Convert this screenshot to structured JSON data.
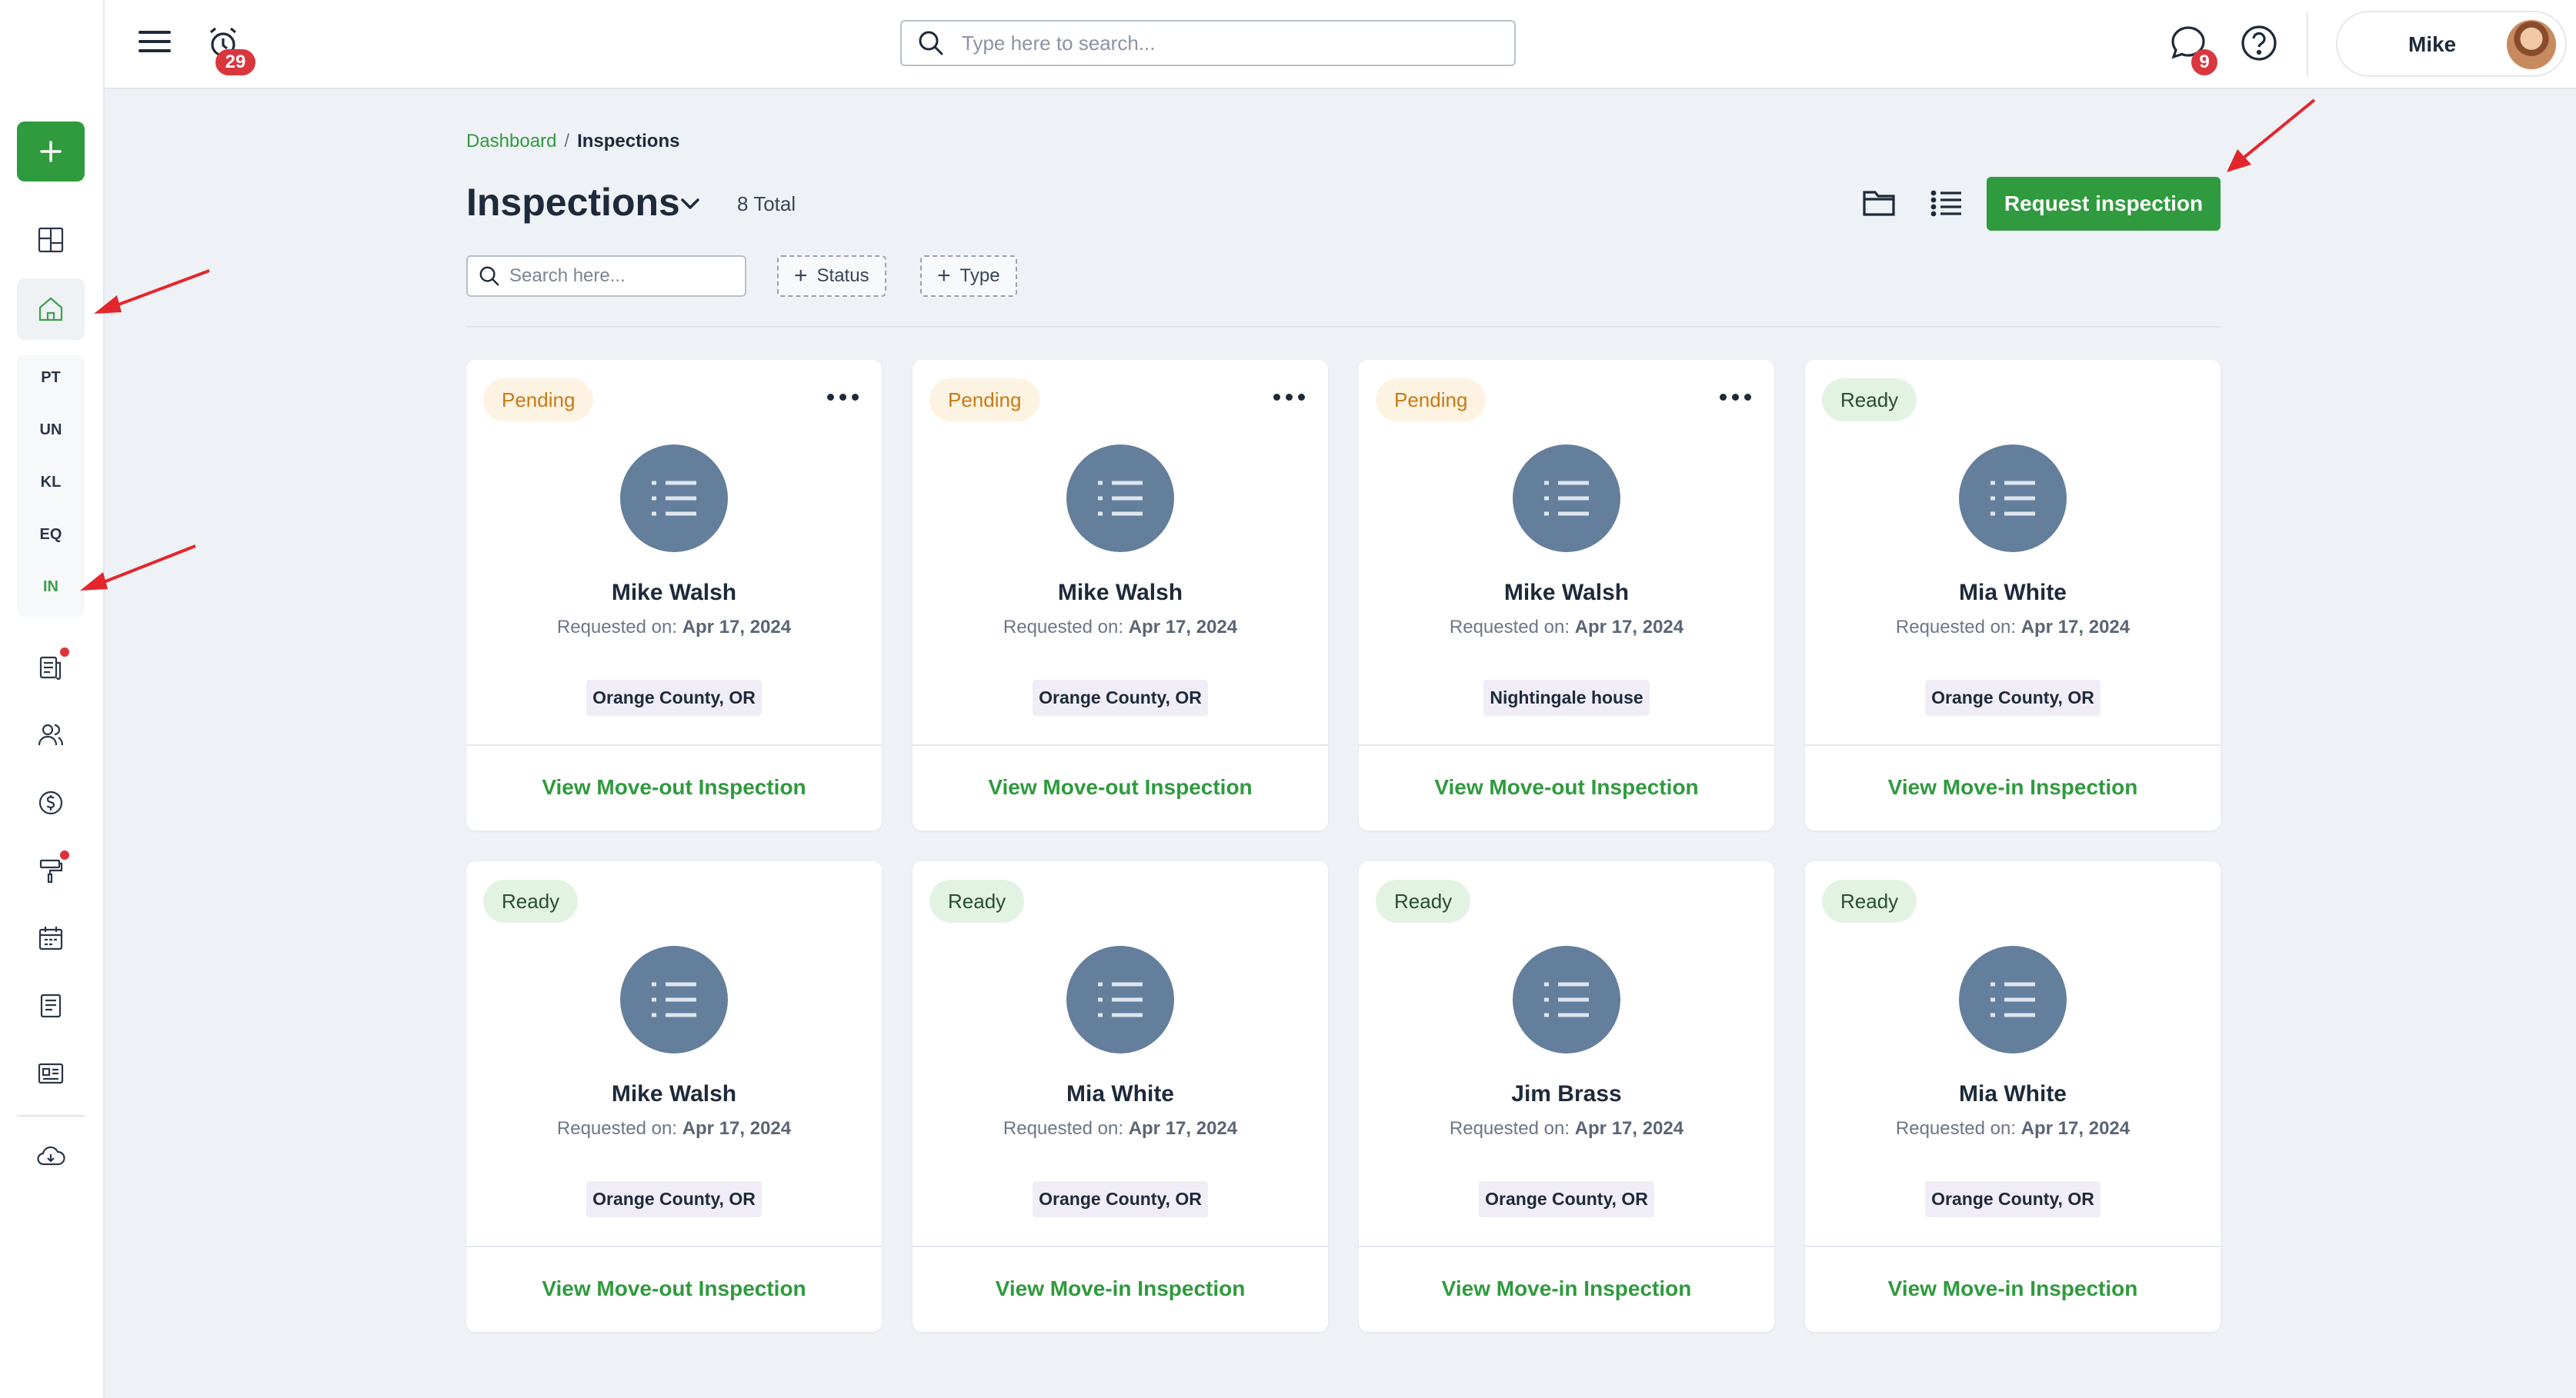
{
  "topbar": {
    "notifications_count": "29",
    "search_placeholder": "Type here to search...",
    "messages_count": "9",
    "user_name": "Mike"
  },
  "sidebar": {
    "abbreviations": [
      "PT",
      "UN",
      "KL",
      "EQ",
      "IN"
    ],
    "active": "IN"
  },
  "breadcrumb": {
    "root": "Dashboard",
    "separator": "/",
    "current": "Inspections"
  },
  "header": {
    "title": "Inspections",
    "total": "8 Total",
    "request_button": "Request inspection"
  },
  "filters": {
    "search_placeholder": "Search here...",
    "status_label": "Status",
    "type_label": "Type"
  },
  "requested_label": "Requested on:",
  "cards": [
    {
      "status": "Pending",
      "name": "Mike Walsh",
      "date": "Apr 17, 2024",
      "location": "Orange County, OR",
      "action": "View Move-out Inspection"
    },
    {
      "status": "Pending",
      "name": "Mike Walsh",
      "date": "Apr 17, 2024",
      "location": "Orange County, OR",
      "action": "View Move-out Inspection"
    },
    {
      "status": "Pending",
      "name": "Mike Walsh",
      "date": "Apr 17, 2024",
      "location": "Nightingale house",
      "action": "View Move-out Inspection"
    },
    {
      "status": "Ready",
      "name": "Mia White",
      "date": "Apr 17, 2024",
      "location": "Orange County, OR",
      "action": "View Move-in Inspection"
    },
    {
      "status": "Ready",
      "name": "Mike Walsh",
      "date": "Apr 17, 2024",
      "location": "Orange County, OR",
      "action": "View Move-out Inspection"
    },
    {
      "status": "Ready",
      "name": "Mia White",
      "date": "Apr 17, 2024",
      "location": "Orange County, OR",
      "action": "View Move-in Inspection"
    },
    {
      "status": "Ready",
      "name": "Jim Brass",
      "date": "Apr 17, 2024",
      "location": "Orange County, OR",
      "action": "View Move-in Inspection"
    },
    {
      "status": "Ready",
      "name": "Mia White",
      "date": "Apr 17, 2024",
      "location": "Orange County, OR",
      "action": "View Move-in Inspection"
    }
  ],
  "colors": {
    "accent": "#2f9a3e",
    "pending_bg": "#fdf3e3",
    "pending_text": "#c97a12",
    "ready_bg": "#e2f3e4",
    "avatar_bg": "#647f9b",
    "badge": "#d9363e"
  }
}
